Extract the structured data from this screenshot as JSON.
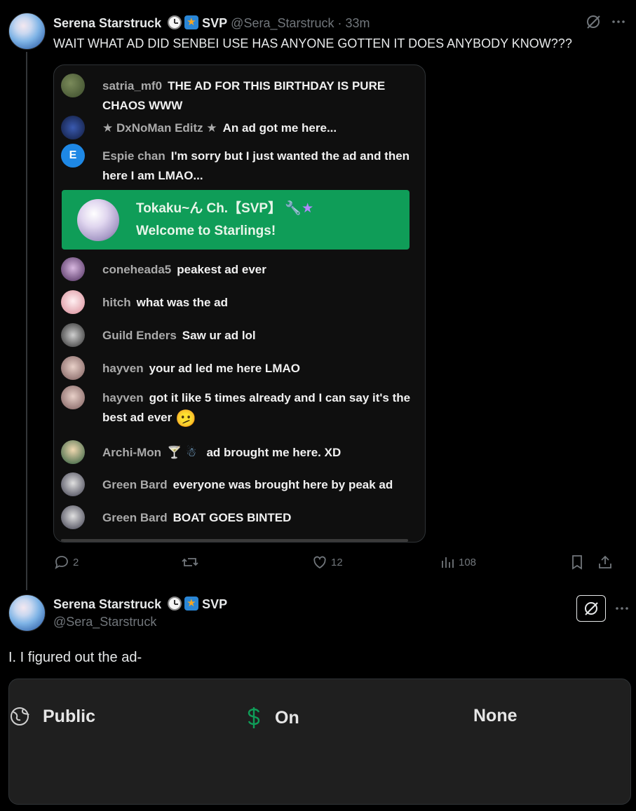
{
  "post1": {
    "display_name": "Serena Starstruck",
    "badge_text": "SVP",
    "handle": "@Sera_Starstruck",
    "separator": "·",
    "time": "33m",
    "text": "WAIT WHAT AD DID SENBEI USE HAS ANYONE GOTTEN IT DOES ANYBODY KNOW???",
    "chat": {
      "messages": [
        {
          "author": "satria_mf0",
          "text": "THE AD FOR THIS BIRTHDAY IS PURE CHAOS WWW",
          "avatar_color": "#4a5a3a"
        },
        {
          "author": "★ DxNoMan Editz ★",
          "text": "An ad got me here...",
          "avatar_color": "#1b2d5e"
        },
        {
          "author": "Espie chan",
          "text": "I'm sorry but I just wanted the ad and then here I am LMAO...",
          "avatar_color": "#1e88e5",
          "avatar_letter": "E"
        },
        {
          "author": "coneheada5",
          "text": "peakest ad ever",
          "avatar_color": "#6b4d7a"
        },
        {
          "author": "hitch",
          "text": "what was the ad",
          "avatar_color": "#e6b8c2"
        },
        {
          "author": "Guild Enders",
          "text": "Saw ur ad lol",
          "avatar_color": "#555555"
        },
        {
          "author": "hayven",
          "text": "your ad led me here LMAO",
          "avatar_color": "#b08f8f"
        },
        {
          "author": "hayven",
          "text": "got it like 5 times already and I can say it's the best ad ever",
          "avatar_color": "#b08f8f",
          "emoji": "🫤"
        },
        {
          "author": "Archi-Mon",
          "text": "ad brought me here. XD",
          "avatar_color": "#3a6a48"
        },
        {
          "author": "Green Bard",
          "text": "everyone was brought here by peak ad",
          "avatar_color": "#8a8a8a"
        },
        {
          "author": "Green Bard",
          "text": "BOAT GOES BINTED",
          "avatar_color": "#8a8a8a"
        }
      ],
      "membership": {
        "author": "Tokaku~ん Ch.【SVP】",
        "message": "Welcome to Starlings!",
        "accent": "#0f9d58"
      }
    },
    "stats": {
      "replies": "2",
      "likes": "12",
      "views": "108"
    }
  },
  "post2": {
    "display_name": "Serena Starstruck",
    "badge_text": "SVP",
    "handle": "@Sera_Starstruck",
    "text": "I. I figured out the ad-",
    "settings": {
      "visibility": "Public",
      "monetization": "On",
      "restrictions": "None",
      "monetization_color": "#0f9d58"
    }
  },
  "icons": [
    "grok-icon",
    "more-icon",
    "reply-icon",
    "repost-icon",
    "like-icon",
    "views-icon",
    "bookmark-icon",
    "share-icon",
    "globe-icon",
    "dollar-icon"
  ]
}
